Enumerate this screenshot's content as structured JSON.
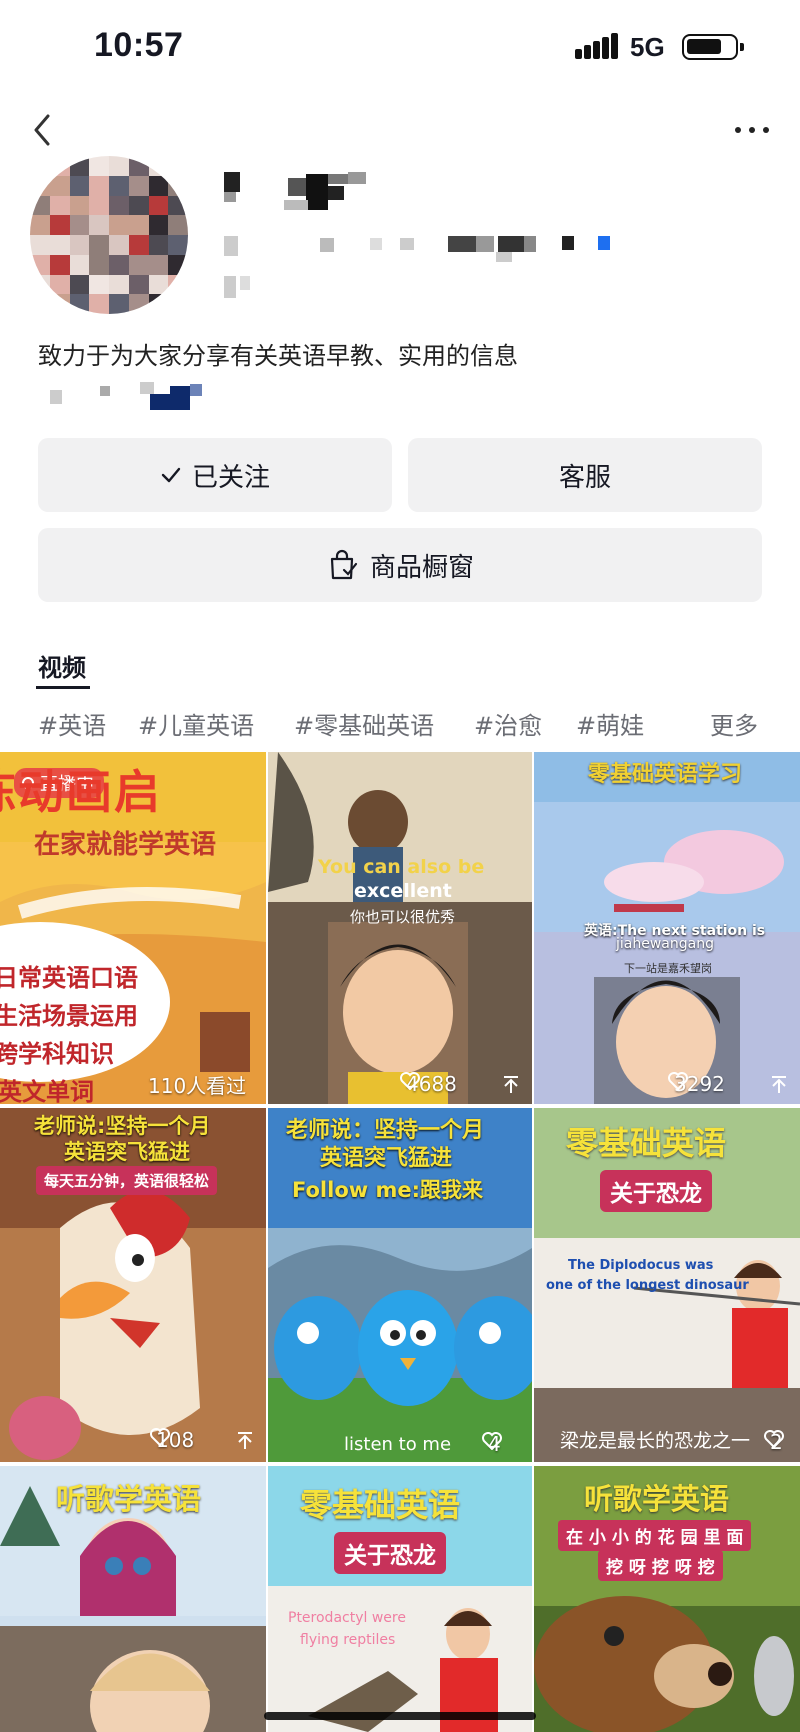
{
  "status_bar": {
    "time": "10:57",
    "network": "5G"
  },
  "nav": {
    "back_icon": "chevron-left-icon",
    "more_icon": "more-horizontal-icon"
  },
  "profile": {
    "bio": "致力于为大家分享有关英语早教、实用的信息",
    "follow_label": "已关注",
    "service_label": "客服",
    "shop_label": "商品橱窗"
  },
  "tabs": {
    "video": "视频"
  },
  "tags": [
    "#英语",
    "#儿童英语",
    "#零基础英语",
    "#治愈",
    "#萌娃",
    "更多"
  ],
  "videos": [
    {
      "badge": "直播中",
      "title": "陈动画启",
      "subtitle": "在家就能学英语",
      "lines": [
        "日常英语口语",
        "生活场景运用",
        "跨学科知识",
        "英文单词"
      ],
      "stat": "110人看过"
    },
    {
      "caption_en_1": "You can also be",
      "caption_en_2": "excellent",
      "caption_cn": "你也可以很优秀",
      "likes": "4688"
    },
    {
      "title": "零基础英语学习",
      "caption_en_1": "英语:The next station is",
      "caption_en_2": "jiahewangang",
      "caption_cn": "下一站是嘉禾望岗",
      "likes": "3292"
    },
    {
      "title_1": "老师说:坚持一个月",
      "title_2": "英语突飞猛进",
      "subtitle": "每天五分钟，英语很轻松",
      "likes": "108"
    },
    {
      "title_1": "老师说：坚持一个月",
      "title_2": "英语突飞猛进",
      "subtitle": "Follow me:跟我来",
      "caption": "listen to me",
      "likes": "4"
    },
    {
      "title": "零基础英语",
      "subtitle": "关于恐龙",
      "caption_en_1": "The Diplodocus was",
      "caption_en_2": "one of the longest dinosaur",
      "caption_cn": "梁龙是最长的恐龙之一",
      "likes": "2"
    },
    {
      "title": "听歌学英语"
    },
    {
      "title": "零基础英语",
      "subtitle": "关于恐龙",
      "caption_en_1": "Pterodactyl were",
      "caption_en_2": "flying reptiles"
    },
    {
      "title": "听歌学英语",
      "subtitle_1": "在 小 小 的 花 园 里 面",
      "subtitle_2": "挖 呀 挖 呀 挖"
    }
  ]
}
